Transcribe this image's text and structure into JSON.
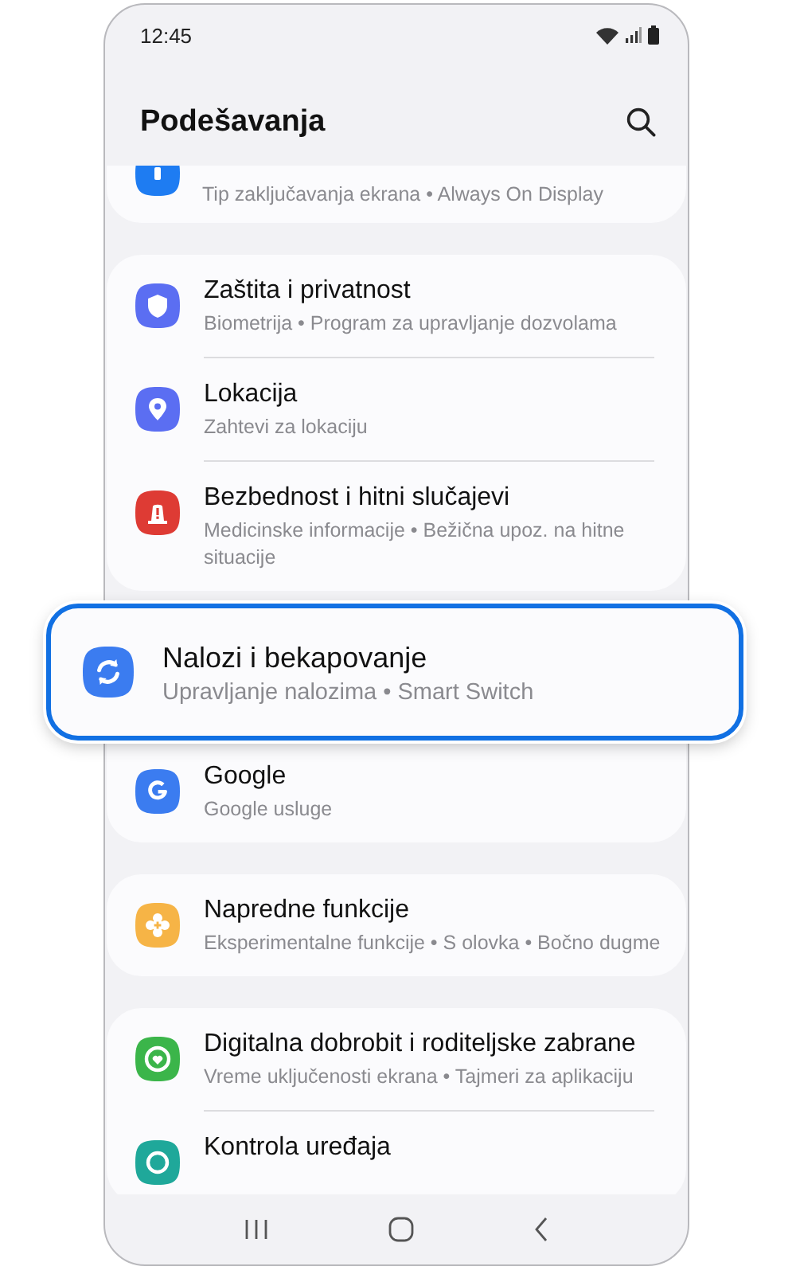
{
  "status_bar": {
    "time": "12:45"
  },
  "header": {
    "title": "Podešavanja"
  },
  "groups": [
    {
      "items": [
        {
          "subtitle": "Tip zaključavanja ekrana • Always On Display",
          "color": "#1e7cf2",
          "highlighted": false
        }
      ]
    },
    {
      "items": [
        {
          "title": "Zaštita i privatnost",
          "subtitle": "Biometrija • Program za upravljanje dozvolama",
          "color": "#5b6ef2",
          "highlighted": false
        },
        {
          "title": "Lokacija",
          "subtitle": "Zahtevi za lokaciju",
          "color": "#5b6ef2",
          "highlighted": false
        },
        {
          "title": "Bezbednost i hitni slučajevi",
          "subtitle": "Medicinske informacije • Bežična upoz. na hitne situacije",
          "color": "#de3b34",
          "highlighted": false
        }
      ]
    },
    {
      "items": [
        {
          "title": "Nalozi i bekapovanje",
          "subtitle": "Upravljanje nalozima • Smart Switch",
          "color": "#3b7cf0",
          "highlighted": true
        },
        {
          "title": "Google",
          "subtitle": "Google usluge",
          "color": "#3b7cf0",
          "highlighted": false
        }
      ]
    },
    {
      "items": [
        {
          "title": "Napredne funkcije",
          "subtitle": "Eksperimentalne funkcije • S olovka • Bočno dugme",
          "color": "#f6b446",
          "highlighted": false
        }
      ]
    },
    {
      "items": [
        {
          "title": "Digitalna dobrobit i roditeljske zabrane",
          "subtitle": "Vreme uključenosti ekrana • Tajmeri za aplikaciju",
          "color": "#3bb54a",
          "highlighted": false
        },
        {
          "title": "Kontrola uređaja",
          "color": "#1fa89a",
          "highlighted": false
        }
      ]
    }
  ]
}
